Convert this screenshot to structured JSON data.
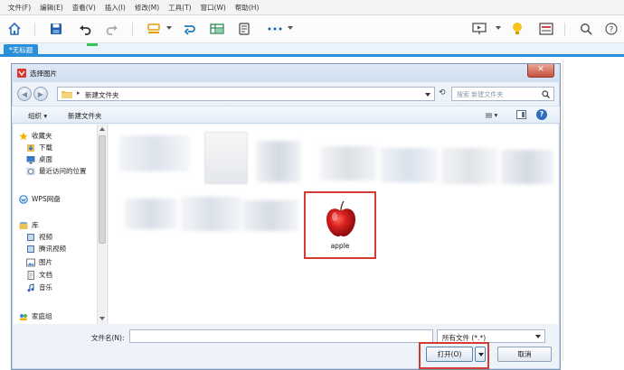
{
  "menubar": {
    "items": [
      "文件(F)",
      "编辑(E)",
      "查看(V)",
      "插入(I)",
      "修改(M)",
      "工具(T)",
      "窗口(W)",
      "帮助(H)"
    ]
  },
  "toolbar": {
    "icons": [
      "home-icon",
      "save-icon",
      "undo-icon",
      "redo-icon",
      "style-icon",
      "link-icon",
      "table-icon",
      "outline-icon",
      "more-icon",
      "present-icon",
      "idea-icon",
      "layout-icon",
      "search-icon",
      "help-icon"
    ]
  },
  "tabs": {
    "document_tab": "*无标题"
  },
  "dialog": {
    "title": "选择图片",
    "close_label": "✕",
    "address": {
      "path": "新建文件夹",
      "chevron": "▸"
    },
    "refresh_label": "⟲",
    "search": {
      "placeholder": "搜索 新建文件夹"
    },
    "commands": {
      "organize": "组织 ▾",
      "new_folder": "新建文件夹",
      "view": "▤ ▾"
    },
    "help_label": "?",
    "nav": {
      "items": [
        {
          "label": "收藏夹",
          "icon": "star-icon"
        },
        {
          "label": "下载",
          "icon": "download-icon"
        },
        {
          "label": "桌面",
          "icon": "desktop-icon"
        },
        {
          "label": "最近访问的位置",
          "icon": "recent-icon"
        },
        {
          "label": "WPS网盘",
          "icon": "cloud-icon"
        },
        {
          "label": "库",
          "icon": "library-icon"
        },
        {
          "label": "视频",
          "icon": "video-icon"
        },
        {
          "label": "腾讯视频",
          "icon": "video-icon"
        },
        {
          "label": "图片",
          "icon": "picture-icon"
        },
        {
          "label": "文档",
          "icon": "document-icon"
        },
        {
          "label": "音乐",
          "icon": "music-icon"
        },
        {
          "label": "家庭组",
          "icon": "homegroup-icon"
        }
      ]
    },
    "file": {
      "name": "apple"
    },
    "filename_label": "文件名(N):",
    "filename_value": "",
    "filetype_selected": "所有文件 (*.*)",
    "open_label": "打开(O)",
    "cancel_label": "取消"
  },
  "colors": {
    "accent": "#2a8fd8",
    "highlight": "#d23a32",
    "apple": "#c8171b"
  }
}
